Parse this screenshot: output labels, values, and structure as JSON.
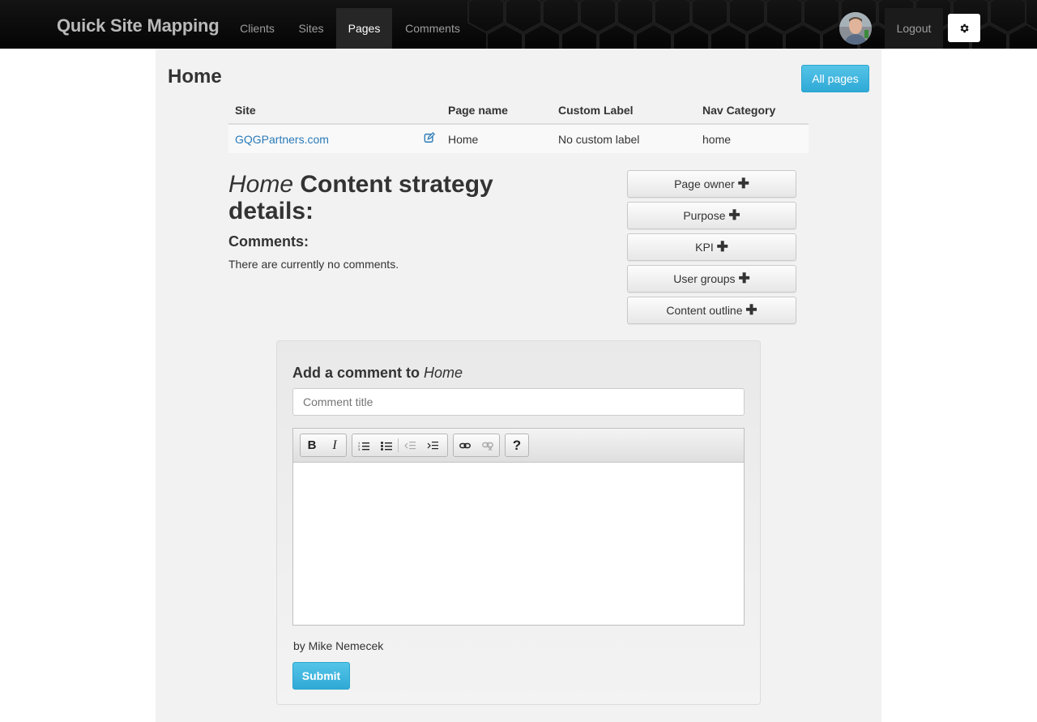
{
  "navbar": {
    "brand": "Quick Site Mapping",
    "items": [
      {
        "label": "Clients",
        "active": false
      },
      {
        "label": "Sites",
        "active": false
      },
      {
        "label": "Pages",
        "active": true
      },
      {
        "label": "Comments",
        "active": false
      }
    ],
    "logout_label": "Logout",
    "avatar_icon": "user-avatar",
    "settings_icon": "gear-icon"
  },
  "page": {
    "title": "Home",
    "all_pages_label": "All pages"
  },
  "table": {
    "headers": [
      "Site",
      "Page name",
      "Custom Label",
      "Nav Category"
    ],
    "rows": [
      {
        "site": "GQGPartners.com",
        "page_name": "Home",
        "custom_label": "No custom label",
        "nav_category": "home"
      }
    ]
  },
  "strategy": {
    "page_name": "Home",
    "heading_rest": "Content strategy details:",
    "comments_heading": "Comments:",
    "no_comments": "There are currently no comments."
  },
  "side_buttons": [
    {
      "label": "Page owner"
    },
    {
      "label": "Purpose"
    },
    {
      "label": "KPI"
    },
    {
      "label": "User groups"
    },
    {
      "label": "Content outline"
    }
  ],
  "comment_form": {
    "heading_prefix": "Add a comment to",
    "page_name": "Home",
    "title_placeholder": "Comment title",
    "title_value": "",
    "toolbar": {
      "bold": "B",
      "italic": "I",
      "help": "?"
    },
    "byline": "by Mike Nemecek",
    "submit_label": "Submit"
  },
  "colors": {
    "primary_button": "#39b3d7",
    "link": "#2a7ab8",
    "navbar_bg": "#0a0a0a",
    "container_bg": "#f2f2f2"
  }
}
